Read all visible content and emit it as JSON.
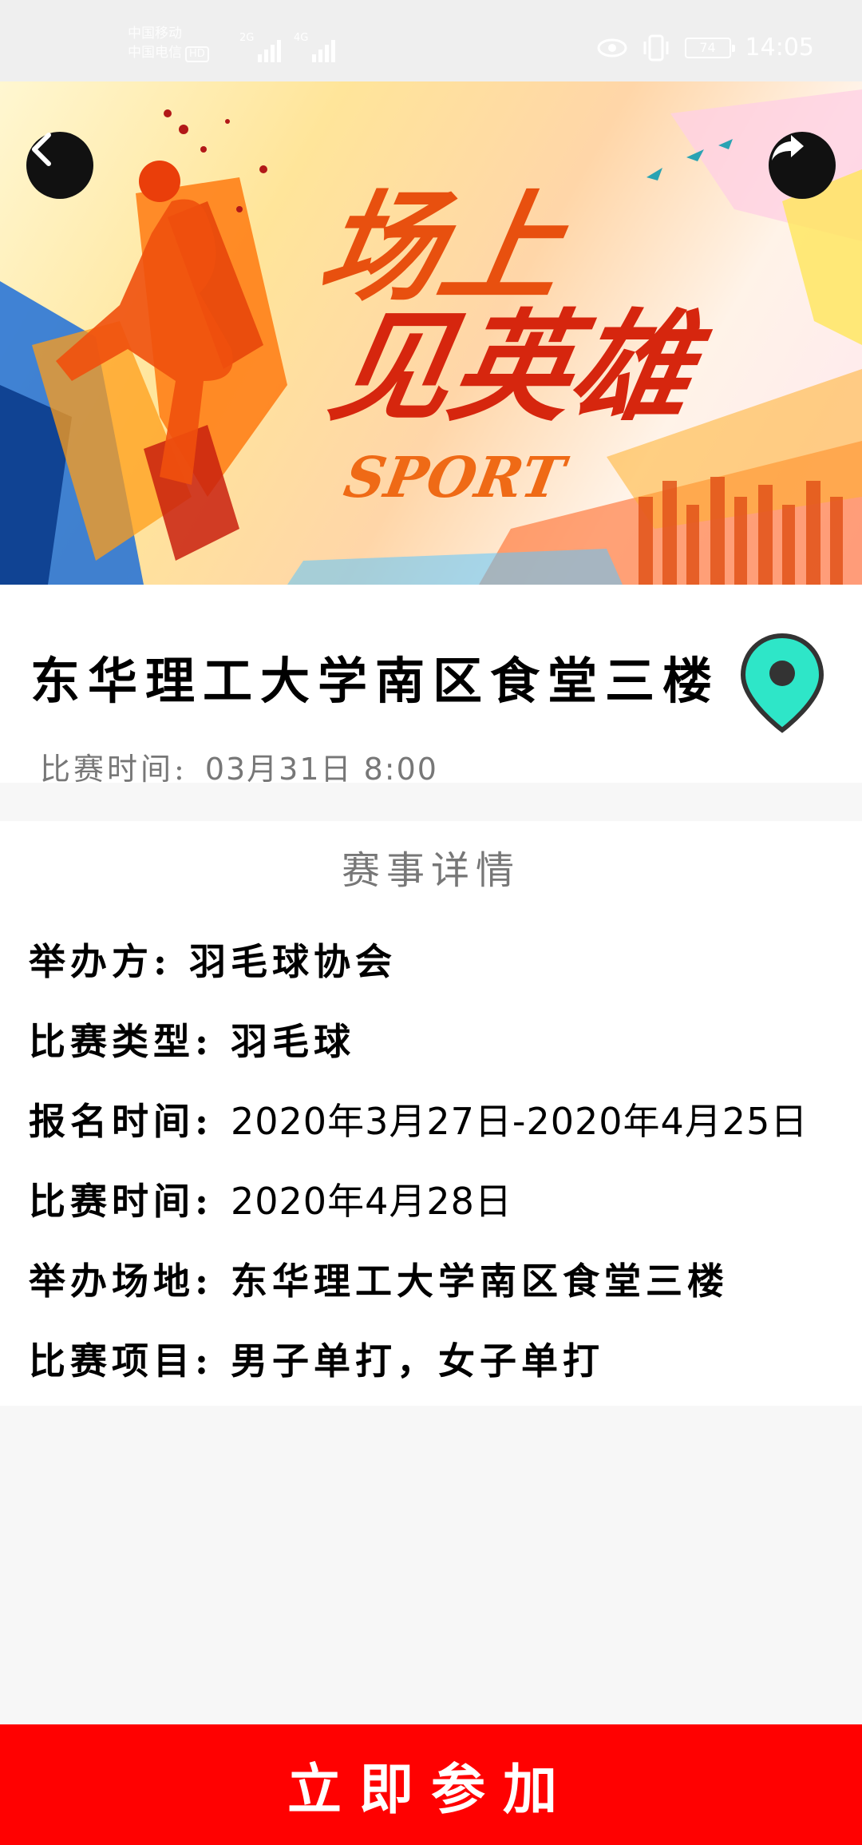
{
  "status_bar": {
    "carrier_1": "中国移动",
    "carrier_2": "中国电信",
    "hd": "HD",
    "net_1": "2G",
    "net_2": "4G",
    "battery": "74",
    "time": "14:05"
  },
  "banner": {
    "title_line_1": "场上",
    "title_line_2": "见英雄",
    "subtitle": "SPORT"
  },
  "info": {
    "venue": "东华理工大学南区食堂三楼",
    "time_label": "比赛时间:",
    "time_value": "03月31日  8:00"
  },
  "details": {
    "heading": "赛事详情",
    "organizer_label": "举办方:",
    "organizer_value": "羽毛球协会",
    "type_label": "比赛类型:",
    "type_value": "羽毛球",
    "signup_label": "报名时间:",
    "signup_value": "2020年3月27日-2020年4月25日",
    "date_label": "比赛时间:",
    "date_value": "2020年4月28日",
    "venue_label": "举办场地:",
    "venue_value": "东华理工大学南区食堂三楼",
    "events_label": "比赛项目:",
    "events_value": "男子单打，女子单打"
  },
  "join_button": "立即参加",
  "colors": {
    "join": "#ff0101",
    "pin": "#2ee6c8",
    "nav_button": "#111111"
  }
}
